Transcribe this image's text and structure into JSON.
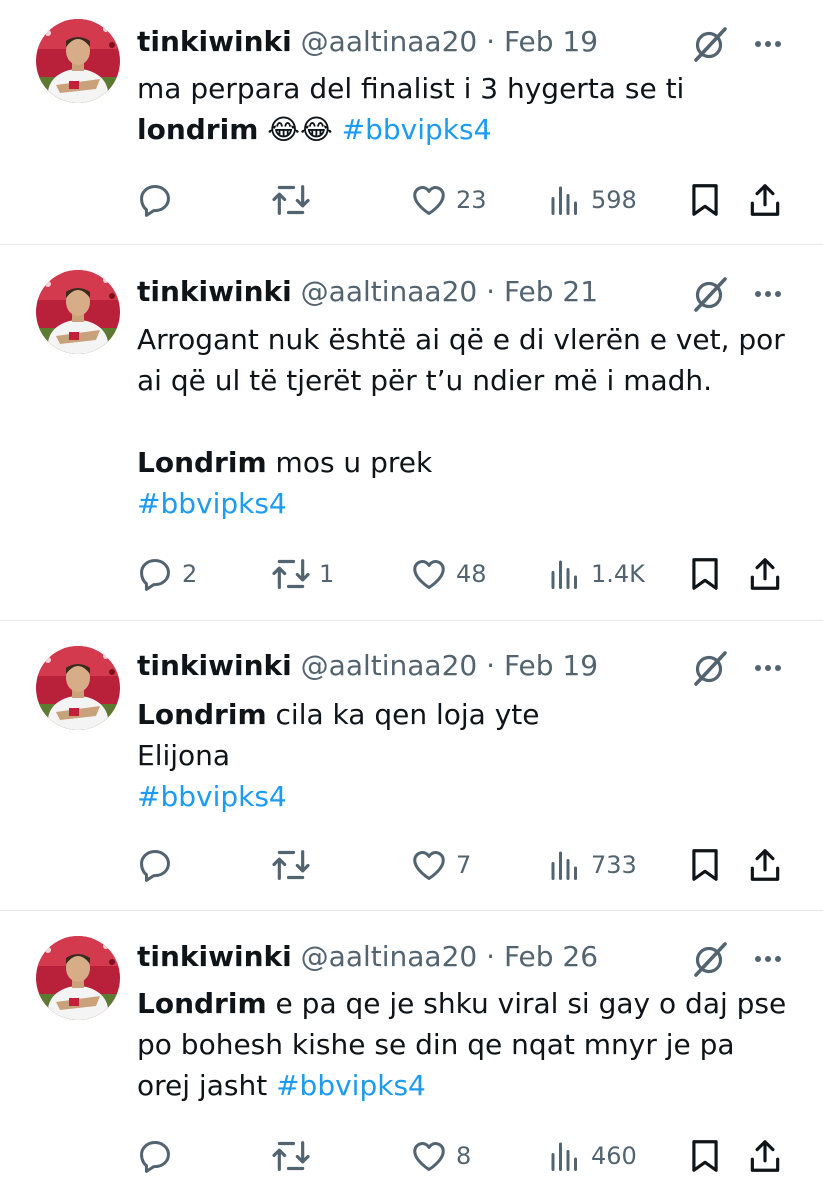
{
  "colors": {
    "text": "#0f1419",
    "secondary": "#536471",
    "link": "#1d9bf0",
    "divider": "#e6e9ec"
  },
  "icons": {
    "reply": "speech-bubble-icon",
    "retweet": "retweet-icon",
    "like": "heart-icon",
    "views": "bar-chart-icon",
    "bookmark": "bookmark-icon",
    "share": "share-icon",
    "grok": "grok-icon",
    "more": "more-dots-icon"
  },
  "tweets": [
    {
      "name": "tinkiwinki",
      "handle": "@aaltinaa20",
      "sep": "·",
      "date": "Feb 19",
      "body": {
        "l1": "ma perpara del finalist i 3 hygerta se ti",
        "l2_bold": "londrim",
        "l2_emoji": " 😂😂 ",
        "l2_tag": " #bbvipks4"
      },
      "stats": {
        "replies": "",
        "retweets": "",
        "likes": "23",
        "views": "598"
      }
    },
    {
      "name": "tinkiwinki",
      "handle": "@aaltinaa20",
      "sep": "·",
      "date": "Feb 21",
      "body": {
        "l1": "Arrogant nuk është ai që e di vlerën e vet, por",
        "l2": "ai që ul të tjerët për t’u ndier më i madh.",
        "l4_bold": " Londrim",
        "l4_rest": " mos u prek",
        "l5_tag": " #bbvipks4"
      },
      "stats": {
        "replies": "2",
        "retweets": "1",
        "likes": "48",
        "views": "1.4K"
      }
    },
    {
      "name": "tinkiwinki",
      "handle": "@aaltinaa20",
      "sep": "·",
      "date": "Feb 19",
      "body": {
        "l1_bold": "Londrim",
        "l1_rest": " cila ka qen loja yte",
        "l2": "Elijona",
        "l3_tag": " #bbvipks4"
      },
      "stats": {
        "replies": "",
        "retweets": "",
        "likes": "7",
        "views": "733"
      }
    },
    {
      "name": "tinkiwinki",
      "handle": "@aaltinaa20",
      "sep": "·",
      "date": "Feb 26",
      "body": {
        "l1_bold": "Londrim",
        "l1_rest": " e pa qe je shku viral si gay o daj pse",
        "l2": "po bohesh kishe se din qe nqat mnyr je pa",
        "l3_rest": "orej jasht ",
        "l3_tag": "#bbvipks4"
      },
      "stats": {
        "replies": "",
        "retweets": "",
        "likes": "8",
        "views": "460"
      }
    }
  ]
}
